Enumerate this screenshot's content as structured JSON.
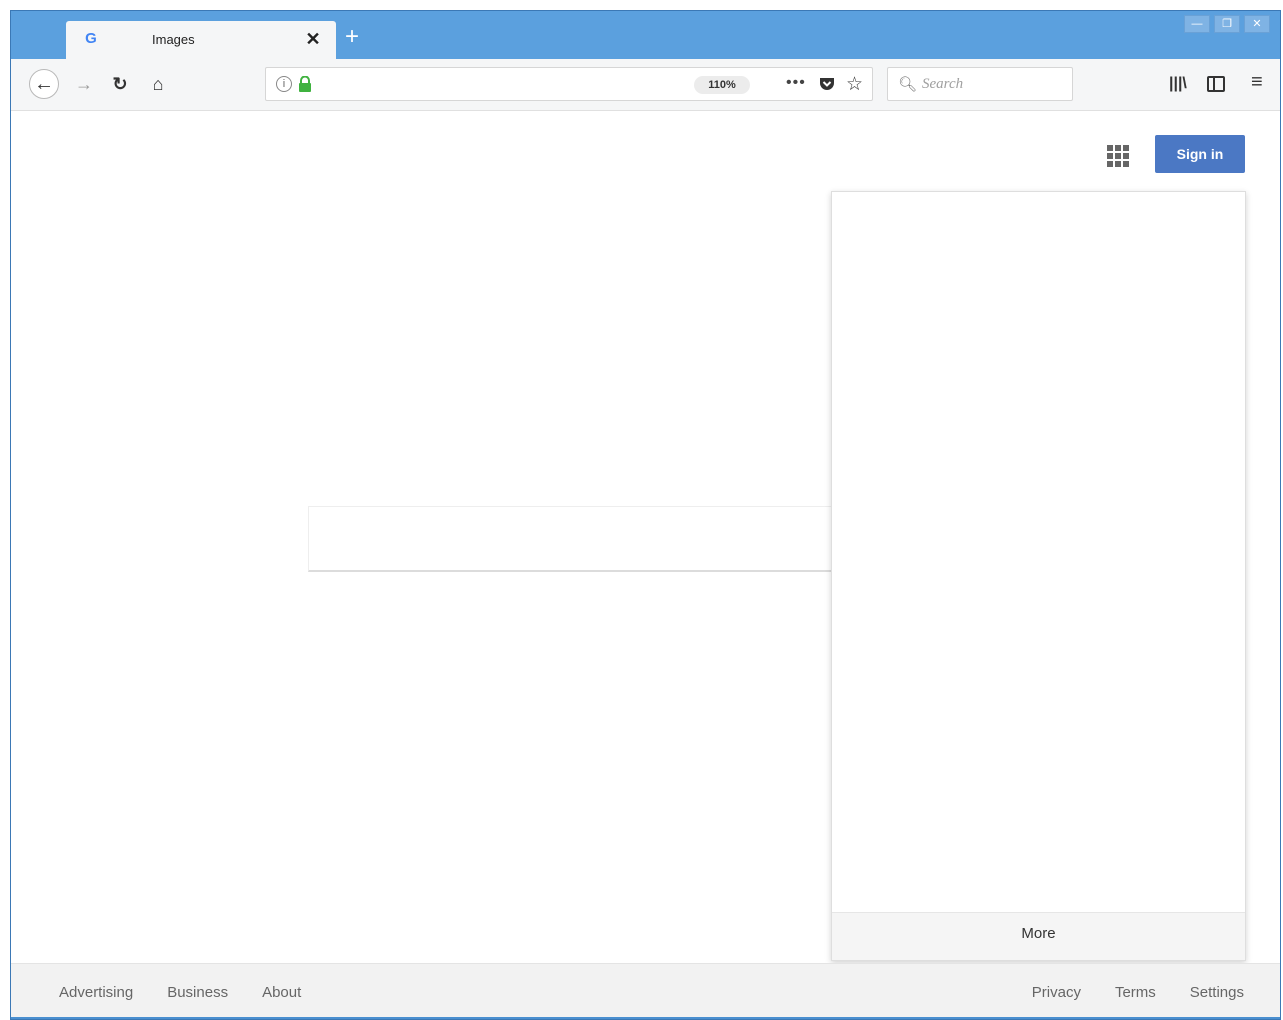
{
  "browser": {
    "tab": {
      "title": "Images",
      "favicon": "G"
    },
    "new_tab_label": "+",
    "window_controls": [
      "—",
      "❐",
      "✕"
    ],
    "zoom": "110%",
    "page_actions": "•••",
    "search": {
      "placeholder": "Search"
    }
  },
  "page": {
    "signin_label": "Sign in",
    "apps_panel": {
      "more_label": "More"
    }
  },
  "footer": {
    "left_links": [
      "Advertising",
      "Business",
      "About"
    ],
    "right_links": [
      "Privacy",
      "Terms",
      "Settings"
    ]
  },
  "colors": {
    "titlebar": "#5ba0de",
    "signin_button": "#4b78c4",
    "lock_icon": "#3fb23f"
  },
  "icons": [
    "back-arrow-icon",
    "forward-arrow-icon",
    "reload-icon",
    "home-icon",
    "info-icon",
    "lock-icon",
    "pocket-icon",
    "star-icon",
    "search-icon",
    "library-icon",
    "sidebar-icon",
    "hamburger-menu-icon",
    "apps-grid-icon"
  ]
}
